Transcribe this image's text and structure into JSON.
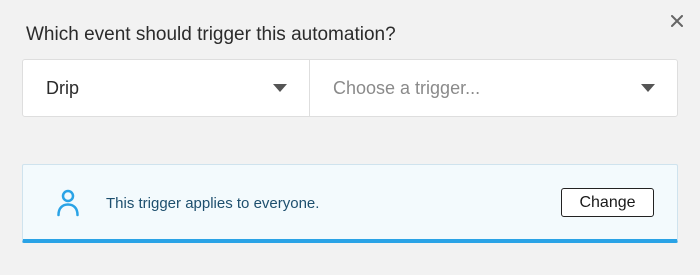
{
  "dialog": {
    "question": "Which event should trigger this automation?",
    "close_icon": "close-icon"
  },
  "event_select": {
    "value": "Drip",
    "icon": "chevron-down-icon"
  },
  "trigger_select": {
    "placeholder": "Choose a trigger...",
    "icon": "chevron-down-icon"
  },
  "notice": {
    "icon": "person-icon",
    "text": "This trigger applies to everyone.",
    "button_label": "Change",
    "accent_color": "#2aa3e6",
    "background_color": "#f3fafd"
  }
}
